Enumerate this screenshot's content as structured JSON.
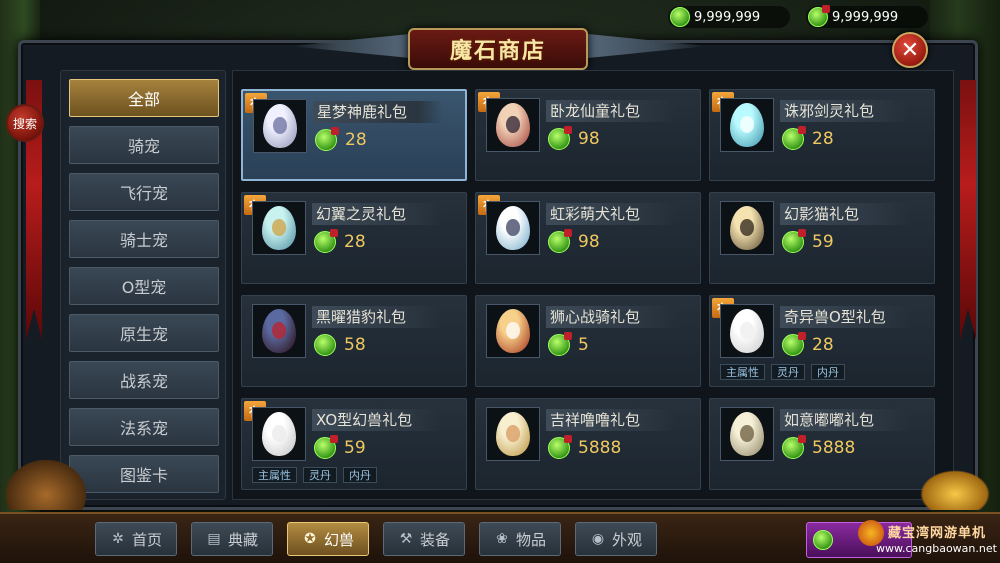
{
  "currency": {
    "gold": "9,999,999",
    "bound_gold": "9,999,999"
  },
  "title": "魔石商店",
  "search_label": "搜索",
  "close_icon": "✕",
  "categories": [
    "全部",
    "骑宠",
    "飞行宠",
    "骑士宠",
    "O型宠",
    "原生宠",
    "战系宠",
    "法系宠",
    "图鉴卡"
  ],
  "active_category": "全部",
  "tag_label": "有",
  "items": [
    {
      "name": "星梦神鹿礼包",
      "price": "28",
      "tag": true,
      "currency": "bound",
      "egg": [
        "#f0f0ff",
        "#8a90b0"
      ],
      "face": "#6a6fa0",
      "selected": true
    },
    {
      "name": "卧龙仙童礼包",
      "price": "98",
      "tag": true,
      "currency": "bound",
      "egg": [
        "#f2d2b6",
        "#a0403a"
      ],
      "face": "#2a2030"
    },
    {
      "name": "诛邪剑灵礼包",
      "price": "28",
      "tag": true,
      "currency": "bound",
      "egg": [
        "#b8fbff",
        "#3a8fa6"
      ],
      "face": "#ffffff"
    },
    {
      "name": "幻翼之灵礼包",
      "price": "28",
      "tag": true,
      "currency": "bound",
      "egg": [
        "#c8f2ef",
        "#4a8aa0"
      ],
      "face": "#d2a040"
    },
    {
      "name": "虹彩萌犬礼包",
      "price": "98",
      "tag": true,
      "currency": "bound",
      "egg": [
        "#ffffff",
        "#6fa8c8"
      ],
      "face": "#3a3f60"
    },
    {
      "name": "幻影猫礼包",
      "price": "59",
      "tag": false,
      "currency": "bound",
      "egg": [
        "#f4e2b0",
        "#5a4a30"
      ],
      "face": "#2a2218"
    },
    {
      "name": "黑曜猎豹礼包",
      "price": "58",
      "tag": false,
      "currency": "gold",
      "egg": [
        "#5a6aa0",
        "#2a0a10"
      ],
      "face": "#c0202a"
    },
    {
      "name": "狮心战骑礼包",
      "price": "5",
      "tag": false,
      "currency": "bound",
      "egg": [
        "#f7d08a",
        "#a0301a"
      ],
      "face": "#ffffff"
    },
    {
      "name": "奇异兽O型礼包",
      "price": "28",
      "tag": true,
      "currency": "bound",
      "egg": [
        "#ffffff",
        "#c8c8c8"
      ],
      "face": "#eeeeee",
      "attrs": [
        "主属性",
        "灵丹",
        "内丹"
      ]
    },
    {
      "name": "XO型幻兽礼包",
      "price": "59",
      "tag": true,
      "currency": "bound",
      "egg": [
        "#ffffff",
        "#c0c0c0"
      ],
      "face": "#eaeaea",
      "attrs": [
        "主属性",
        "灵丹",
        "内丹"
      ]
    },
    {
      "name": "吉祥噜噜礼包",
      "price": "5888",
      "tag": false,
      "currency": "bound",
      "egg": [
        "#f8efd0",
        "#b8923a"
      ],
      "face": "#d89a60"
    },
    {
      "name": "如意嘟嘟礼包",
      "price": "5888",
      "tag": false,
      "currency": "bound",
      "egg": [
        "#f6f0d8",
        "#8a8060"
      ],
      "face": "#6a5a3a"
    }
  ],
  "bottom_nav": [
    {
      "label": "首页",
      "icon": "pinwheel-icon",
      "glyph": "✲"
    },
    {
      "label": "典藏",
      "icon": "scroll-icon",
      "glyph": "▤"
    },
    {
      "label": "幻兽",
      "icon": "beast-icon",
      "glyph": "✪",
      "active": true
    },
    {
      "label": "装备",
      "icon": "axe-icon",
      "glyph": "⚒"
    },
    {
      "label": "物品",
      "icon": "flower-icon",
      "glyph": "❀"
    },
    {
      "label": "外观",
      "icon": "helmet-icon",
      "glyph": "◉"
    }
  ],
  "recharge_label": "充值",
  "watermark": {
    "title": "藏宝湾网游单机",
    "url": "www.cangbaowan.net"
  },
  "colors": {
    "accent_gold": "#e3c47a",
    "price_gold": "#f0c860",
    "tag_orange": "#f3a53a",
    "close_red": "#c0202a"
  }
}
